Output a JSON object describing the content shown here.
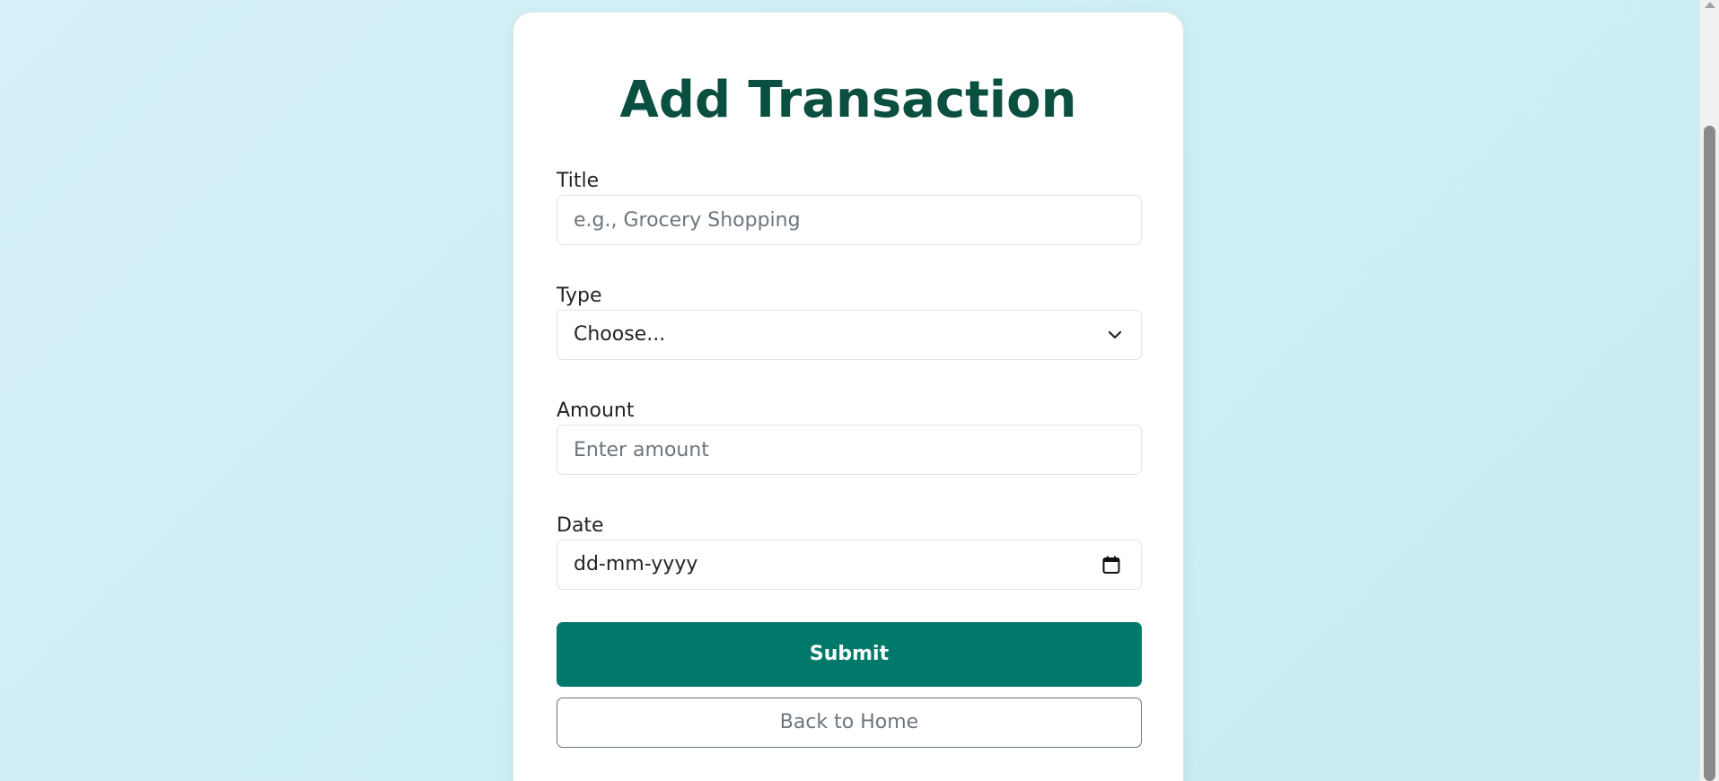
{
  "form": {
    "title": "Add Transaction",
    "title_field": {
      "label": "Title",
      "placeholder": "e.g., Grocery Shopping",
      "value": ""
    },
    "type_field": {
      "label": "Type",
      "selected": "Choose...",
      "icon": "chevron-down-icon"
    },
    "amount_field": {
      "label": "Amount",
      "placeholder": "Enter amount",
      "value": ""
    },
    "date_field": {
      "label": "Date",
      "placeholder": "dd-mm-yyyy",
      "icon": "calendar-icon"
    },
    "submit_label": "Submit",
    "back_label": "Back to Home"
  },
  "colors": {
    "background": "#cdeef5",
    "card": "#ffffff",
    "title": "#0a4f3f",
    "primary_button": "#00796b",
    "secondary_text": "#6c757d"
  }
}
